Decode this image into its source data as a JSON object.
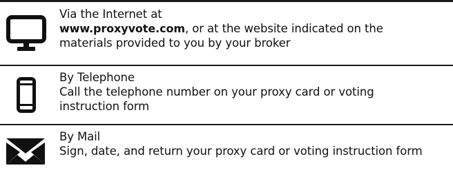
{
  "methods": [
    {
      "icon": "computer-monitor-icon",
      "heading": "Via the Internet at",
      "lines": [
        {
          "emphasis": "www.proxyvote.com",
          "rest": ", or at the website indicated on the"
        },
        {
          "text": "materials provided to you by your broker"
        }
      ]
    },
    {
      "icon": "mobile-phone-icon",
      "heading": "By Telephone",
      "lines": [
        {
          "text": "Call the telephone number on your proxy card or voting"
        },
        {
          "text": "instruction form"
        }
      ]
    },
    {
      "icon": "envelope-icon",
      "heading": "By Mail",
      "lines": [
        {
          "text": "Sign, date, and return your proxy card or voting instruction form"
        }
      ]
    }
  ],
  "colors": {
    "text": "#111111",
    "rules": "#1a1a1a",
    "icons": "#111111"
  }
}
